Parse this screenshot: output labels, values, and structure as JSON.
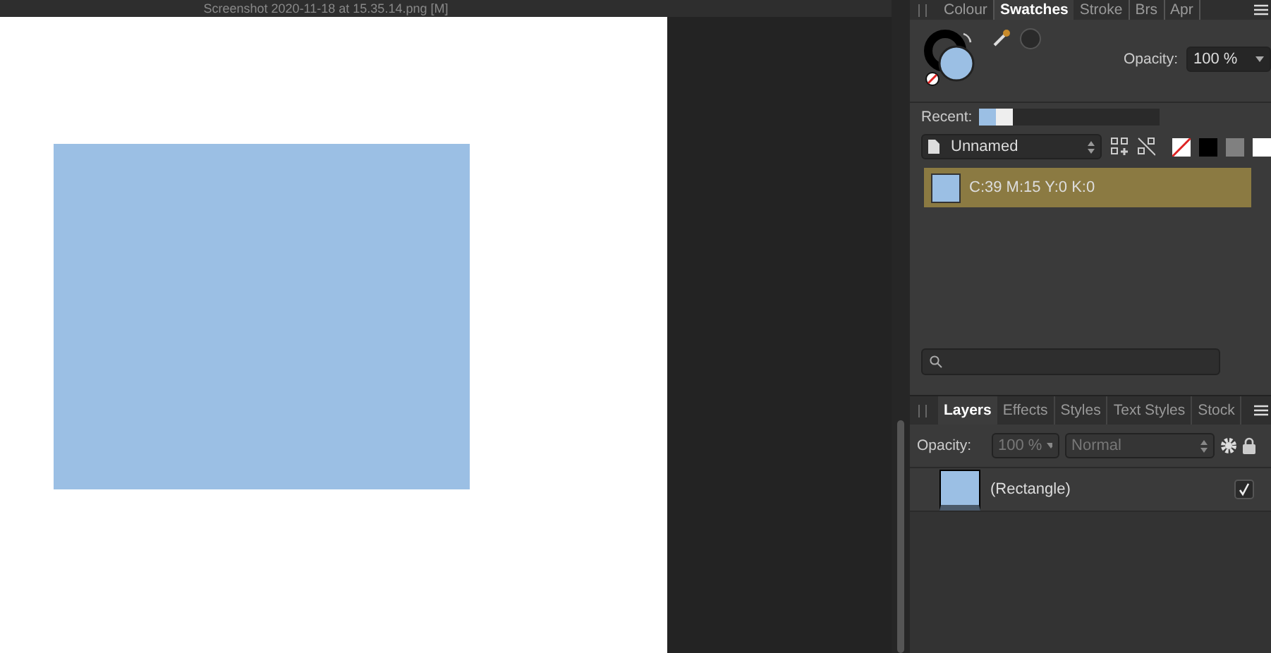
{
  "document": {
    "title": "Screenshot 2020-11-18 at 15.35.14.png [M]"
  },
  "top_tabs": [
    {
      "label": "Colour",
      "selected": false
    },
    {
      "label": "Swatches",
      "selected": true
    },
    {
      "label": "Stroke",
      "selected": false
    },
    {
      "label": "Brs",
      "selected": false
    },
    {
      "label": "Apr",
      "selected": false
    }
  ],
  "swatches": {
    "opacity_label": "Opacity:",
    "opacity_value": "100 %",
    "recent_label": "Recent:",
    "recent": [
      {
        "color": "#9bbfe4"
      },
      {
        "color": "#eeeeee"
      }
    ],
    "palette": "Unnamed",
    "quick": [
      {
        "kind": "none"
      },
      {
        "kind": "color",
        "color": "#000000"
      },
      {
        "kind": "color",
        "color": "#808080"
      },
      {
        "kind": "color",
        "color": "#ffffff"
      }
    ],
    "items": [
      {
        "label": "C:39 M:15 Y:0 K:0",
        "color": "#9bbfe4",
        "selected": true
      }
    ]
  },
  "layer_tabs": [
    {
      "label": "Layers",
      "selected": true
    },
    {
      "label": "Effects",
      "selected": false
    },
    {
      "label": "Styles",
      "selected": false
    },
    {
      "label": "Text Styles",
      "selected": false
    },
    {
      "label": "Stock",
      "selected": false
    }
  ],
  "layers": {
    "opacity_label": "Opacity:",
    "opacity_value": "100 %",
    "blend_mode": "Normal",
    "disabled": true,
    "items": [
      {
        "name": "(Rectangle)",
        "visible": true,
        "selected": false
      }
    ]
  }
}
